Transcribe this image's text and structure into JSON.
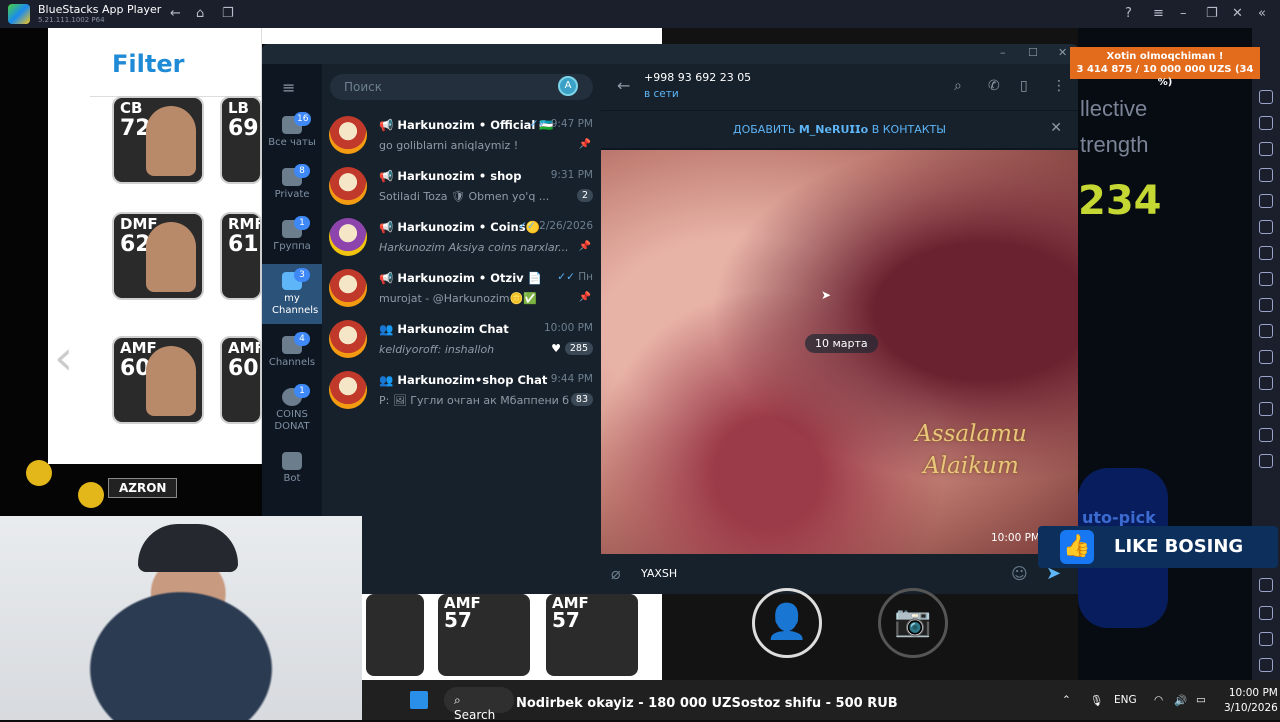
{
  "bluestacks": {
    "title": "BlueStacks App Player",
    "version": "5.21.111.1002  P64"
  },
  "game": {
    "filter_title": "Filter",
    "cards": [
      {
        "pos": "CB",
        "rating": "72"
      },
      {
        "pos": "LB",
        "rating": "69"
      },
      {
        "pos": "DMF",
        "rating": "62"
      },
      {
        "pos": "RMF",
        "rating": "61"
      },
      {
        "pos": "AMF",
        "rating": "60"
      },
      {
        "pos": "AMF",
        "rating": "60"
      }
    ],
    "bottom_cards": [
      {
        "pos": "AMF",
        "rating": "57"
      },
      {
        "pos": "AMF",
        "rating": "57"
      }
    ],
    "right_text": {
      "line1": "llective",
      "line2": "trength",
      "number": "234"
    }
  },
  "overlay": {
    "donate_title": "Xotin olmoqchiman !",
    "donate_progress": "3 414 875 / 10 000 000 UZS (34 %)",
    "donate_fraction": 0.34,
    "like_label": "LIKE BOSING",
    "azron": "AZRON",
    "auto_pick": "uto-pick"
  },
  "telegram": {
    "nav": [
      {
        "label": "Все чаты",
        "badge": "16"
      },
      {
        "label": "Private",
        "badge": "8"
      },
      {
        "label": "Группа",
        "badge": "1"
      },
      {
        "label": "my Channels",
        "badge": "3",
        "active": true
      },
      {
        "label": "Channels",
        "badge": "4"
      },
      {
        "label": "COINS DONAT",
        "badge": "1"
      },
      {
        "label": "Bot",
        "badge": ""
      }
    ],
    "search_placeholder": "Поиск",
    "search_avatar": "A",
    "chats": [
      {
        "name": "📢 Harkunozim • Official 🇺🇿",
        "time": "9:47 PM",
        "check": "✓✓",
        "preview": "go goliblarni aniqlaymiz !",
        "count": "",
        "pin": "📌"
      },
      {
        "name": "📢 Harkunozim • shop",
        "time": "9:31 PM",
        "check": "",
        "preview": "Sotiladi    Toza 🛡 Obmen yo'q ...",
        "count": "2",
        "pin": ""
      },
      {
        "name": "📢 Harkunozim • Coins🟡",
        "time": "2/26/2026",
        "check": "✓✓",
        "preview": "Harkunozim Aksiya coins narxlar...",
        "count": "",
        "pin": "📌"
      },
      {
        "name": "📢 Harkunozim • Otziv 📄",
        "time": "Пн",
        "check": "✓✓",
        "preview": "murojat - @Harkunozim🪙✅",
        "count": "",
        "pin": "📌"
      },
      {
        "name": "👥 Harkunozim Chat",
        "time": "10:00 PM",
        "check": "",
        "preview": "keldiyoroff: inshalloh",
        "count": "285",
        "pin": ""
      },
      {
        "name": "👥 Harkunozim•shop Chat",
        "time": "9:44 PM",
        "check": "",
        "preview": "P: 🖼 Гугли очган ак Мбаппени бл...",
        "count": "83",
        "pin": ""
      }
    ],
    "header": {
      "phone": "+998 93 692 23 05",
      "status": "в сети"
    },
    "add_contact": "ДОБАВИТЬ 𝗠_𝗡𝗲𝗥𝗨𝗜𝗜𝗼 В КОНТАКТЫ",
    "date_pill": "10 марта",
    "greeting": "Assalamu Alaikum",
    "photo_time": "10:00 PM",
    "composer_text": "YAXSH"
  },
  "taskbar": {
    "search": "Search",
    "ticker": "Nodirbek okayiz - 180 000 UZSostoz shifu - 500 RUB",
    "lang": "ENG",
    "time": "10:00 PM",
    "date": "3/10/2026"
  }
}
